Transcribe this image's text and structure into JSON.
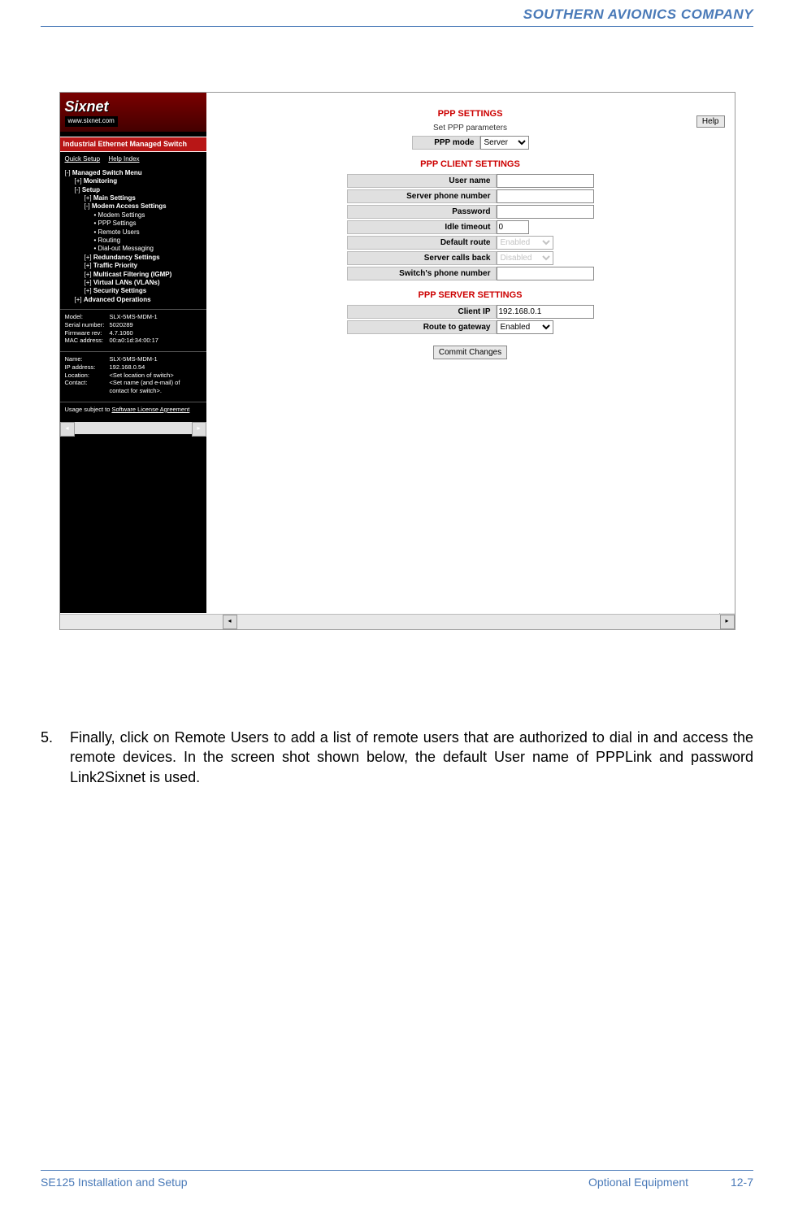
{
  "header": {
    "company": "SOUTHERN AVIONICS COMPANY"
  },
  "screenshot": {
    "logo": {
      "brand": "Sixnet",
      "url": "www.sixnet.com"
    },
    "banner": "Industrial Ethernet Managed Switch",
    "nav": {
      "quick": "Quick Setup",
      "help": "Help Index"
    },
    "tree": {
      "root": "Managed Switch Menu",
      "monitoring": "Monitoring",
      "setup": "Setup",
      "main_settings": "Main Settings",
      "modem_access": "Modem Access Settings",
      "modem_settings": "Modem Settings",
      "ppp_settings": "PPP Settings",
      "remote_users": "Remote Users",
      "routing": "Routing",
      "dialout": "Dial-out Messaging",
      "redundancy": "Redundancy Settings",
      "traffic": "Traffic Priority",
      "multicast": "Multicast Filtering (IGMP)",
      "vlans": "Virtual LANs (VLANs)",
      "security": "Security Settings",
      "advanced": "Advanced Operations"
    },
    "info1": {
      "model_l": "Model:",
      "model_v": "SLX-5MS-MDM-1",
      "serial_l": "Serial number:",
      "serial_v": "5020289",
      "fw_l": "Firmware rev:",
      "fw_v": "4.7.1060",
      "mac_l": "MAC address:",
      "mac_v": "00:a0:1d:34:00:17"
    },
    "info2": {
      "name_l": "Name:",
      "name_v": "SLX-5MS-MDM-1",
      "ip_l": "IP address:",
      "ip_v": "192.168.0.54",
      "loc_l": "Location:",
      "loc_v": "<Set location of switch>",
      "contact_l": "Contact:",
      "contact_v": "<Set name (and e-mail) of contact for switch>."
    },
    "license": {
      "prefix": "Usage subject to ",
      "link": "Software License Agreement"
    },
    "main": {
      "help": "Help",
      "title1": "PPP SETTINGS",
      "sub1": "Set PPP parameters",
      "ppp_mode_l": "PPP mode",
      "ppp_mode_v": "Server",
      "title2": "PPP CLIENT SETTINGS",
      "user_l": "User name",
      "phone_l": "Server phone number",
      "pass_l": "Password",
      "idle_l": "Idle timeout",
      "idle_v": "0",
      "route_l": "Default route",
      "route_v": "Enabled",
      "callback_l": "Server calls back",
      "callback_v": "Disabled",
      "switch_phone_l": "Switch's phone number",
      "title3": "PPP SERVER SETTINGS",
      "client_ip_l": "Client IP",
      "client_ip_v": "192.168.0.1",
      "gateway_l": "Route to gateway",
      "gateway_v": "Enabled",
      "commit": "Commit Changes"
    }
  },
  "step": {
    "num": "5.",
    "text": "Finally, click on Remote Users to add a list of remote users that are authorized to dial in and access the remote devices. In the screen shot shown below, the default User name of PPPLink and password Link2Sixnet is used."
  },
  "footer": {
    "left": "SE125 Installation and Setup",
    "center": "Optional Equipment",
    "right": "12-7"
  }
}
